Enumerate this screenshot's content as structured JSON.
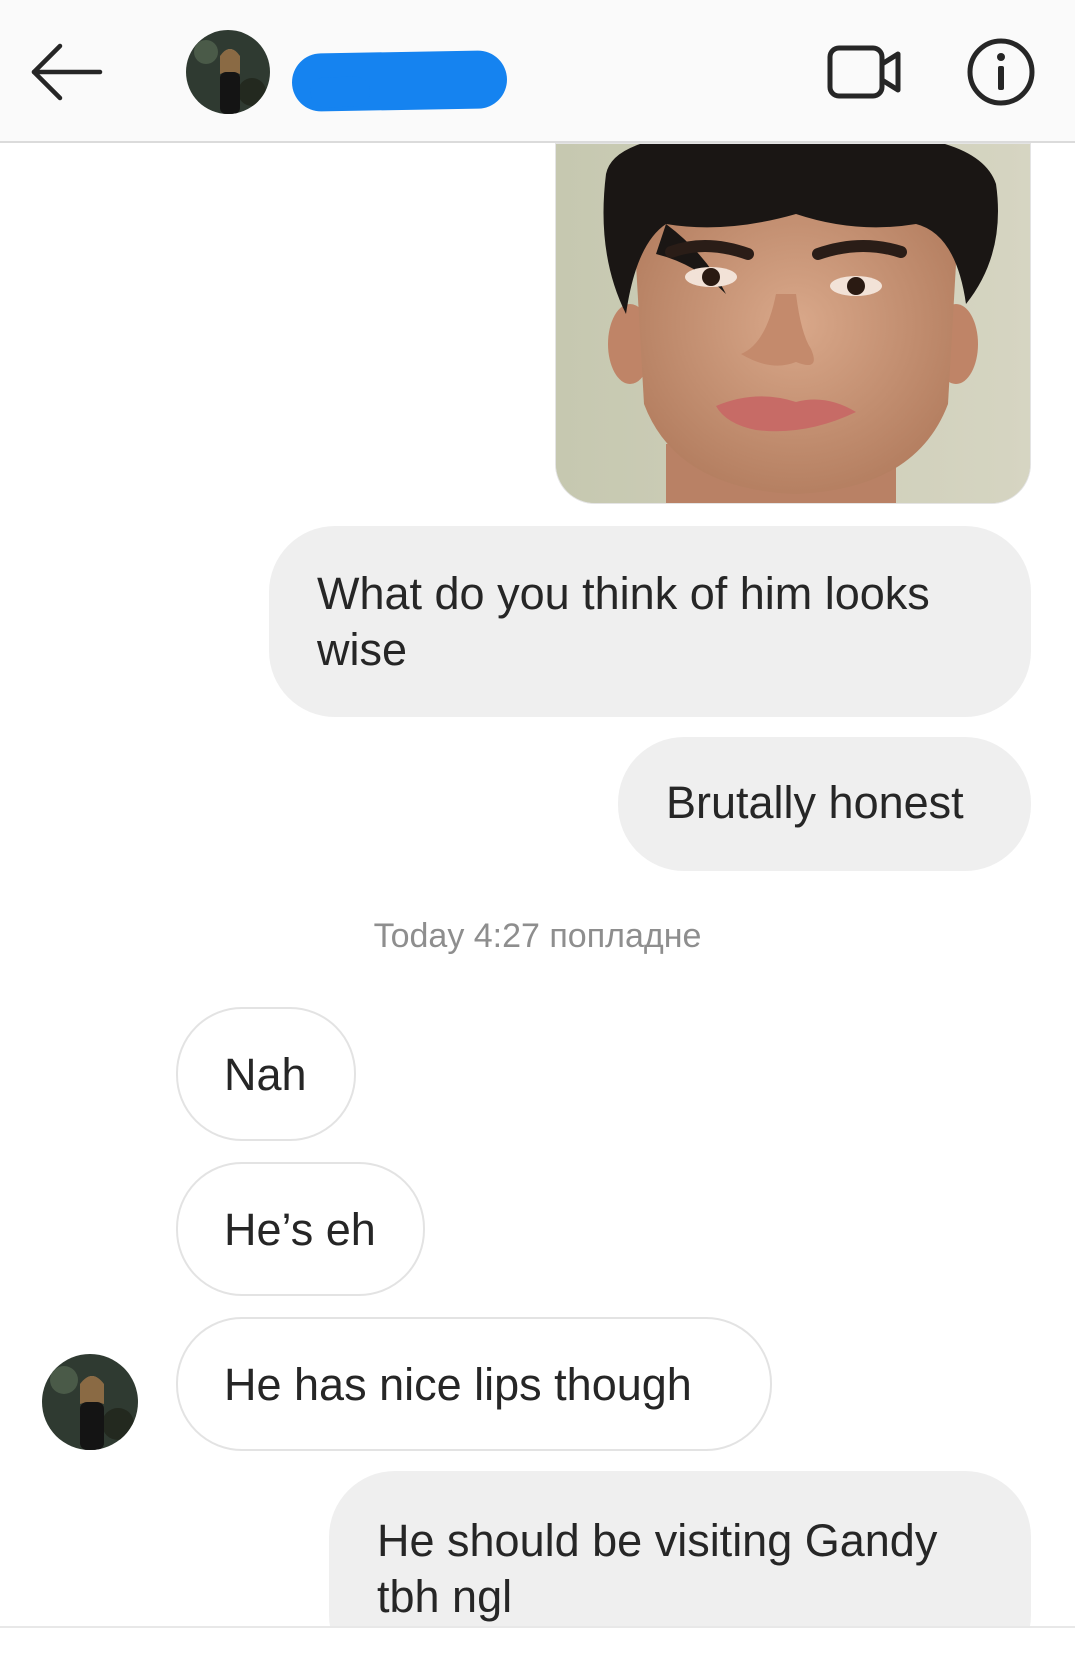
{
  "header": {
    "back_icon": "arrow-left-icon",
    "avatar": "profile-avatar",
    "username_redacted": true,
    "video_icon": "video-camera-icon",
    "info_icon": "info-circle-icon"
  },
  "messages": {
    "photo": "shared-photo",
    "outgoing_1": "What do you think of him looks wise",
    "outgoing_2": "Brutally honest",
    "timestamp": "Today 4:27 попладне",
    "incoming_1": "Nah",
    "incoming_2": "He’s eh",
    "incoming_3": "He has nice lips though",
    "outgoing_3": "He should be visiting Gandy tbh ngl"
  },
  "colors": {
    "header_bg": "#fafafa",
    "outgoing_bubble": "#efefef",
    "incoming_border": "#e3e3e3",
    "text": "#262626",
    "timestamp": "#8e8e8e",
    "redaction": "#1583f0"
  }
}
